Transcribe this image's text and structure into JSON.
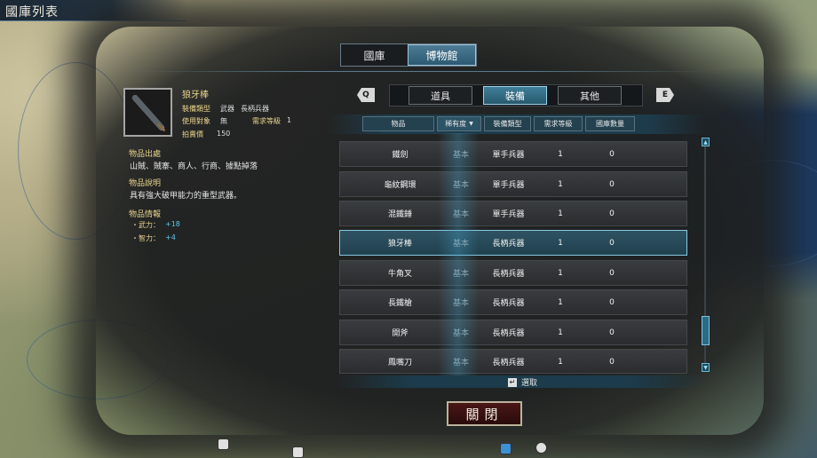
{
  "window": {
    "title": "國庫列表"
  },
  "top_tabs": [
    {
      "label": "國庫",
      "active": false
    },
    {
      "label": "博物館",
      "active": true
    }
  ],
  "item": {
    "name": "狼牙棒",
    "props": {
      "type_label": "裝備類型",
      "type_value": "武器",
      "type_sub": "長柄兵器",
      "user_label": "使用對象",
      "user_value": "無",
      "level_label": "需求等級",
      "level_value": "1",
      "price_label": "拍賣價",
      "price_value": "150"
    },
    "source_heading": "物品出處",
    "source_text": "山賊、賊寨、商人、行商、據點掉落",
    "desc_heading": "物品說明",
    "desc_text": "具有強大破甲能力的重型武器。",
    "info_heading": "物品情報",
    "bonuses": [
      {
        "label": "・武力：",
        "value": "+18"
      },
      {
        "label": "・智力：",
        "value": "+4"
      }
    ]
  },
  "category": {
    "prev_key": "Q",
    "next_key": "E",
    "tabs": [
      {
        "label": "道具",
        "active": false
      },
      {
        "label": "裝備",
        "active": true
      },
      {
        "label": "其他",
        "active": false
      }
    ]
  },
  "columns": [
    "物品",
    "稀有度",
    "裝備類型",
    "需求等級",
    "國庫數量"
  ],
  "rows": [
    {
      "name": "鐵劍",
      "rarity": "基本",
      "type": "單手兵器",
      "level": "1",
      "qty": "0"
    },
    {
      "name": "龜紋鋼環",
      "rarity": "基本",
      "type": "單手兵器",
      "level": "1",
      "qty": "0"
    },
    {
      "name": "混鐵錘",
      "rarity": "基本",
      "type": "單手兵器",
      "level": "1",
      "qty": "0"
    },
    {
      "name": "狼牙棒",
      "rarity": "基本",
      "type": "長柄兵器",
      "level": "1",
      "qty": "0"
    },
    {
      "name": "牛角叉",
      "rarity": "基本",
      "type": "長柄兵器",
      "level": "1",
      "qty": "0"
    },
    {
      "name": "長鐵槍",
      "rarity": "基本",
      "type": "長柄兵器",
      "level": "1",
      "qty": "0"
    },
    {
      "name": "開斧",
      "rarity": "基本",
      "type": "長柄兵器",
      "level": "1",
      "qty": "0"
    },
    {
      "name": "鳳嘴刀",
      "rarity": "基本",
      "type": "長柄兵器",
      "level": "1",
      "qty": "0"
    }
  ],
  "footer": {
    "select_label": "選取"
  },
  "close_label": "關閉",
  "colors": {
    "accent": "#3f7e98",
    "gold_text": "#e9d38c",
    "bonus_blue": "#5bc8f0",
    "close_bg": "#4a1717"
  }
}
